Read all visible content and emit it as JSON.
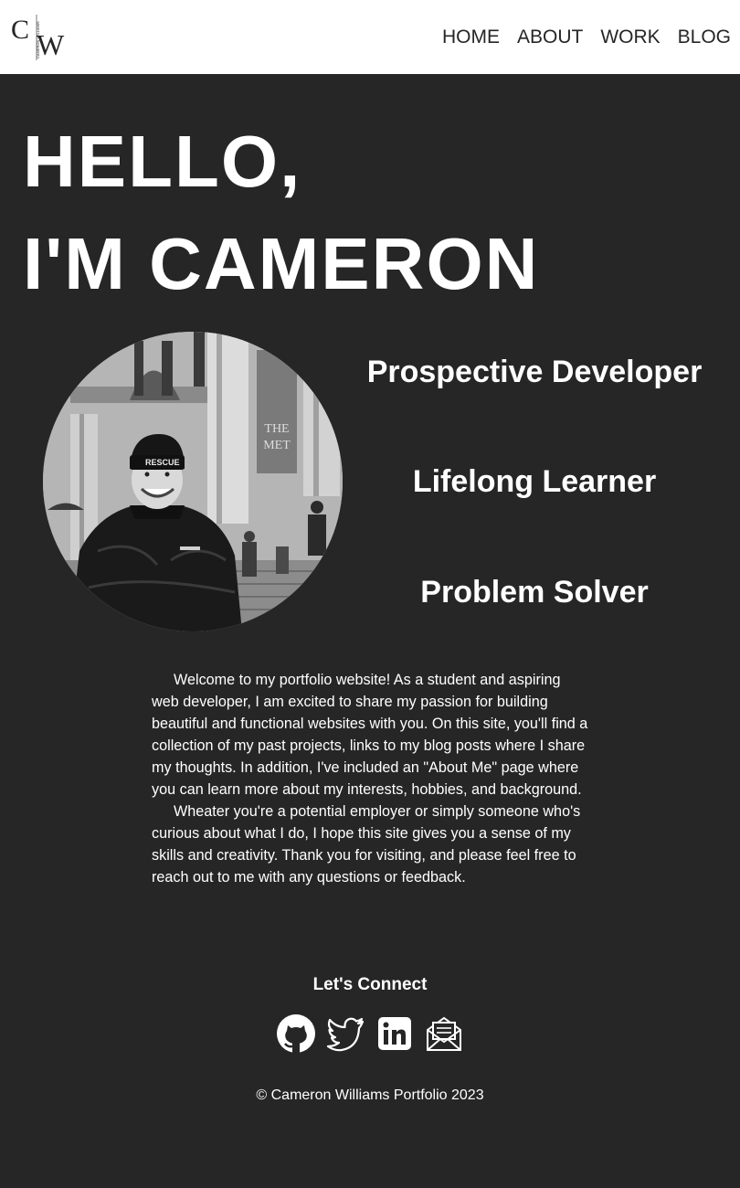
{
  "header": {
    "logo_alt": "CW monogram logo",
    "nav": [
      {
        "label": "HOME"
      },
      {
        "label": "ABOUT"
      },
      {
        "label": "WORK"
      },
      {
        "label": "BLOG"
      }
    ]
  },
  "hero": {
    "line1": "HELLO,",
    "line2": "I'M CAMERON"
  },
  "roles": [
    {
      "label": "Prospective Developer"
    },
    {
      "label": "Lifelong Learner"
    },
    {
      "label": "Problem Solver"
    }
  ],
  "portrait": {
    "icon": "portrait-photo"
  },
  "intro": {
    "paragraph1": "Welcome to my portfolio website! As a student and aspiring web developer, I am excited to share my passion for building beautiful and functional websites with you. On this site, you'll find a collection of my past projects, links to my blog posts where I share my thoughts. In addition, I've included an \"About Me\" page where you can learn more about my interests, hobbies, and background.",
    "paragraph2": "Wheater you're a potential employer or simply someone who's curious about what I do, I hope this site gives you a sense of my skills and creativity. Thank you for visiting, and please feel free to reach out to me with any questions or feedback."
  },
  "connect": {
    "title": "Let's Connect",
    "links": [
      {
        "icon": "github-icon"
      },
      {
        "icon": "twitter-icon"
      },
      {
        "icon": "linkedin-icon"
      },
      {
        "icon": "mail-icon"
      }
    ]
  },
  "footer": {
    "copyright": "© Cameron Williams Portfolio 2023"
  },
  "colors": {
    "background": "#262626",
    "header_background": "#ffffff",
    "text": "#ffffff",
    "nav_text": "#262626"
  }
}
